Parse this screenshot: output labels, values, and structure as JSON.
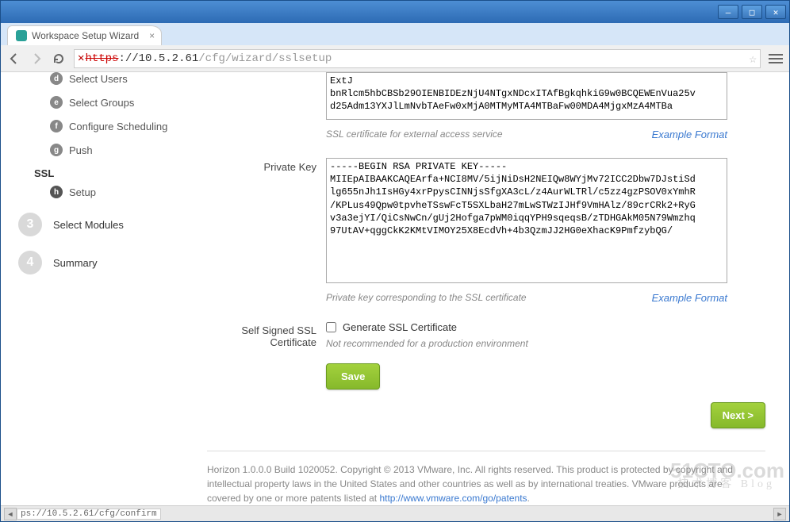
{
  "window": {
    "tab_title": "Workspace Setup Wizard"
  },
  "url": {
    "scheme": "https",
    "host_path": "://10.5.2.61",
    "path": "/cfg/wizard/sslsetup"
  },
  "sidebar": {
    "sub_steps": [
      {
        "bullet": "d",
        "label": "Select Users"
      },
      {
        "bullet": "e",
        "label": "Select Groups"
      },
      {
        "bullet": "f",
        "label": "Configure Scheduling"
      },
      {
        "bullet": "g",
        "label": "Push"
      }
    ],
    "ssl_heading": "SSL",
    "ssl_sub": {
      "bullet": "h",
      "label": "Setup"
    },
    "big_steps": [
      {
        "num": "3",
        "label": "Select Modules"
      },
      {
        "num": "4",
        "label": "Summary"
      }
    ]
  },
  "form": {
    "cert_text": "ExtJ\nbnRlcm5hbCBSb29OIENBIDEzNjU4NTgxNDcxITAfBgkqhkiG9w0BCQEWEnVua25v\nd25Adm13YXJlLmNvbTAeFw0xMjA0MTMyMTA4MTBaFw00MDA4MjgxMzA4MTBa",
    "cert_hint": "SSL certificate for external access service",
    "example_link": "Example Format",
    "key_label": "Private Key",
    "key_text": "-----BEGIN RSA PRIVATE KEY-----\nMIIEpAIBAAKCAQEArfa+NCI8MV/5ijNiDsH2NEIQw8WYjMv72ICC2Dbw7DJstiSd\nlg655nJh1IsHGy4xrPpysCINNjsSfgXA3cL/z4AurWLTRl/c5zz4gzPSOV0xYmhR\n/KPLus49Qpw0tpvheTSswFcT5SXLbaH27mLwSTWzIJHf9VmHAlz/89crCRk2+RyG\nv3a3ejYI/QiCsNwCn/gUj2Hofga7pWM0iqqYPH9sqeqsB/zTDHGAkM05N79Wmzhq\n97UtAV+qggCkK2KMtVIMOY25X8EcdVh+4b3QzmJJ2HG0eXhacK9PmfzybQG/",
    "key_hint": "Private key corresponding to the SSL certificate",
    "selfsigned_label": "Self Signed SSL Certificate",
    "selfsigned_checkbox": "Generate SSL Certificate",
    "selfsigned_hint": "Not recommended for a production environment",
    "save_btn": "Save",
    "next_btn": "Next >"
  },
  "footer": {
    "text1": "Horizon 1.0.0.0 Build 1020052. Copyright © 2013 VMware, Inc. All rights reserved. This product is protected by copyright and intellectual property laws in the United States and other countries as well as by international treaties. VMware products are covered by one or more patents listed at ",
    "link": "http://www.vmware.com/go/patents",
    "text2": "."
  },
  "statusbar": {
    "url": "ps://10.5.2.61/cfg/confirm"
  },
  "watermark": {
    "main": "51CTO.com",
    "sub": "技术博客  Blog"
  }
}
